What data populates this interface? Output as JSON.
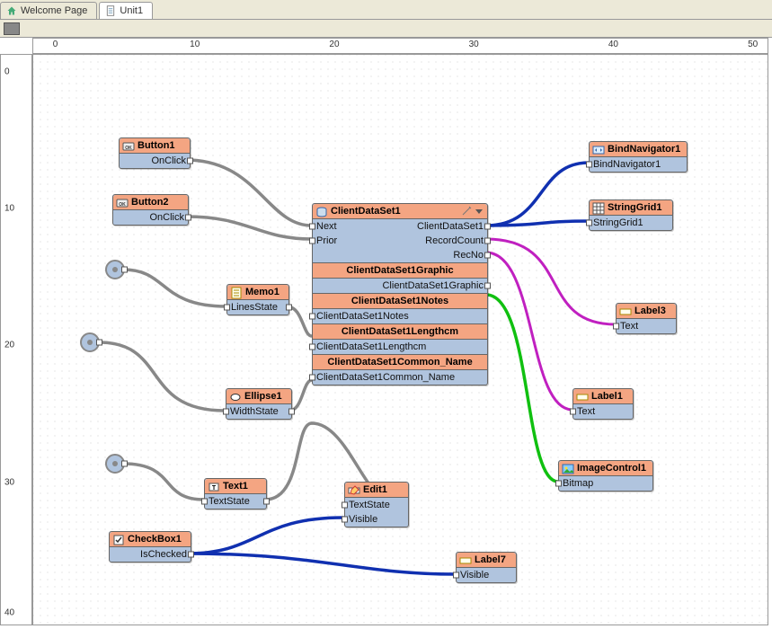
{
  "tabs": {
    "welcome": "Welcome Page",
    "unit": "Unit1"
  },
  "ruler_h": [
    "0",
    "10",
    "20",
    "30",
    "40",
    "50"
  ],
  "ruler_v": [
    "0",
    "10",
    "20",
    "30",
    "40"
  ],
  "nodes": {
    "button1": {
      "title": "Button1",
      "row": "OnClick"
    },
    "button2": {
      "title": "Button2",
      "row": "OnClick"
    },
    "memo1": {
      "title": "Memo1",
      "row": "LinesState"
    },
    "ellipse1": {
      "title": "Ellipse1",
      "row": "WidthState"
    },
    "text1": {
      "title": "Text1",
      "row": "TextState"
    },
    "checkbox1": {
      "title": "CheckBox1",
      "row": "IsChecked"
    },
    "edit1": {
      "title": "Edit1",
      "row1": "TextState",
      "row2": "Visible"
    },
    "label7": {
      "title": "Label7",
      "row": "Visible"
    },
    "label1": {
      "title": "Label1",
      "row": "Text"
    },
    "label3": {
      "title": "Label3",
      "row": "Text"
    },
    "bindnav": {
      "title": "BindNavigator1",
      "row": "BindNavigator1"
    },
    "stringgrid": {
      "title": "StringGrid1",
      "row": "StringGrid1"
    },
    "imagectrl": {
      "title": "ImageControl1",
      "row": "Bitmap"
    },
    "cds": {
      "title": "ClientDataSet1",
      "next": "Next",
      "prior": "Prior",
      "out_ds": "ClientDataSet1",
      "out_rc": "RecordCount",
      "out_rn": "RecNo",
      "s1h": "ClientDataSet1Graphic",
      "s1": "ClientDataSet1Graphic",
      "s2h": "ClientDataSet1Notes",
      "s2": "ClientDataSet1Notes",
      "s3h": "ClientDataSet1Lengthcm",
      "s3": "ClientDataSet1Lengthcm",
      "s4h": "ClientDataSet1Common_Name",
      "s4": "ClientDataSet1Common_Name"
    }
  },
  "chart_data": {
    "type": "diagram",
    "nodes": [
      {
        "id": "Button1",
        "props": [
          "OnClick"
        ],
        "x": 8,
        "y": 6
      },
      {
        "id": "Button2",
        "props": [
          "OnClick"
        ],
        "x": 7,
        "y": 10
      },
      {
        "id": "Memo1",
        "props": [
          "LinesState"
        ],
        "x": 15,
        "y": 15
      },
      {
        "id": "Ellipse1",
        "props": [
          "WidthState"
        ],
        "x": 15,
        "y": 22
      },
      {
        "id": "Text1",
        "props": [
          "TextState"
        ],
        "x": 14,
        "y": 27
      },
      {
        "id": "CheckBox1",
        "props": [
          "IsChecked"
        ],
        "x": 7,
        "y": 32
      },
      {
        "id": "Edit1",
        "props": [
          "TextState",
          "Visible"
        ],
        "x": 23,
        "y": 29
      },
      {
        "id": "Label7",
        "props": [
          "Visible"
        ],
        "x": 31,
        "y": 33
      },
      {
        "id": "Label1",
        "props": [
          "Text"
        ],
        "x": 40,
        "y": 22
      },
      {
        "id": "Label3",
        "props": [
          "Text"
        ],
        "x": 42,
        "y": 17
      },
      {
        "id": "BindNavigator1",
        "props": [
          "BindNavigator1"
        ],
        "x": 40,
        "y": 6
      },
      {
        "id": "StringGrid1",
        "props": [
          "StringGrid1"
        ],
        "x": 40,
        "y": 10
      },
      {
        "id": "ImageControl1",
        "props": [
          "Bitmap"
        ],
        "x": 38,
        "y": 27
      },
      {
        "id": "ClientDataSet1",
        "props": [
          "Next",
          "Prior",
          "ClientDataSet1",
          "RecordCount",
          "RecNo",
          "ClientDataSet1Graphic",
          "ClientDataSet1Notes",
          "ClientDataSet1Lengthcm",
          "ClientDataSet1Common_Name"
        ],
        "x": 21,
        "y": 10
      }
    ],
    "edges": [
      {
        "from": "Button1.OnClick",
        "to": "ClientDataSet1.Next",
        "color": "gray"
      },
      {
        "from": "Button2.OnClick",
        "to": "ClientDataSet1.Prior",
        "color": "gray"
      },
      {
        "from": "source1",
        "to": "Memo1.LinesState",
        "color": "gray"
      },
      {
        "from": "source2",
        "to": "Ellipse1.WidthState",
        "color": "gray"
      },
      {
        "from": "source3",
        "to": "Text1.TextState",
        "color": "gray"
      },
      {
        "from": "Memo1.LinesState",
        "to": "ClientDataSet1.ClientDataSet1Notes",
        "color": "gray"
      },
      {
        "from": "Ellipse1.WidthState",
        "to": "ClientDataSet1.ClientDataSet1Lengthcm",
        "color": "gray"
      },
      {
        "from": "Text1.TextState",
        "to": "ClientDataSet1.ClientDataSet1Common_Name",
        "color": "gray"
      },
      {
        "from": "Edit1.TextState",
        "to": "ClientDataSet1.ClientDataSet1Common_Name",
        "color": "gray"
      },
      {
        "from": "Edit1.Visible",
        "to": "CheckBox1.IsChecked",
        "color": "blue"
      },
      {
        "from": "CheckBox1.IsChecked",
        "to": "Label7.Visible",
        "color": "blue"
      },
      {
        "from": "ClientDataSet1.ClientDataSet1",
        "to": "BindNavigator1.BindNavigator1",
        "color": "blue"
      },
      {
        "from": "ClientDataSet1.ClientDataSet1",
        "to": "StringGrid1.StringGrid1",
        "color": "blue"
      },
      {
        "from": "ClientDataSet1.RecordCount",
        "to": "Label3.Text",
        "color": "magenta"
      },
      {
        "from": "ClientDataSet1.RecNo",
        "to": "Label1.Text",
        "color": "magenta"
      },
      {
        "from": "ClientDataSet1.ClientDataSet1Graphic",
        "to": "ImageControl1.Bitmap",
        "color": "green"
      }
    ]
  }
}
